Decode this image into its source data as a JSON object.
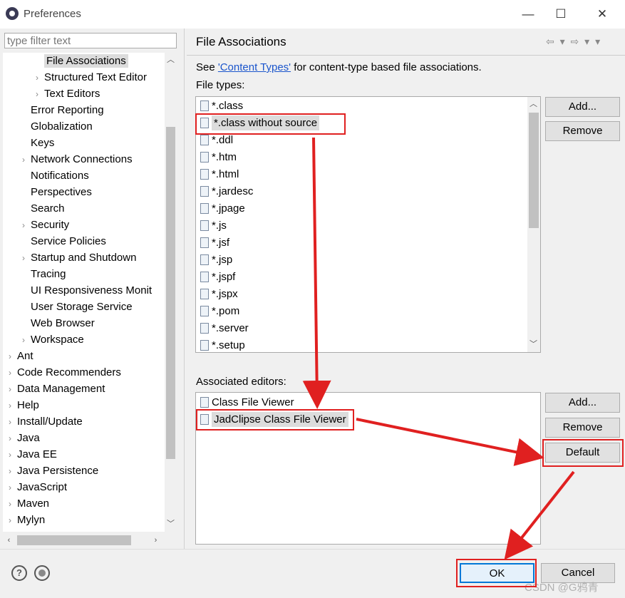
{
  "window": {
    "title": "Preferences",
    "controls": [
      "minimize-icon",
      "maximize-icon",
      "close-icon"
    ],
    "minimize": "—",
    "maximize": "☐",
    "close": "✕"
  },
  "filter": {
    "placeholder": "type filter text",
    "value": ""
  },
  "tree": {
    "items": [
      {
        "label": "File Associations",
        "indent": 2,
        "chevron": false,
        "selected": true
      },
      {
        "label": "Structured Text Editor",
        "indent": 2,
        "chevron": true
      },
      {
        "label": "Text Editors",
        "indent": 2,
        "chevron": true
      },
      {
        "label": "Error Reporting",
        "indent": 1,
        "chevron": false
      },
      {
        "label": "Globalization",
        "indent": 1,
        "chevron": false
      },
      {
        "label": "Keys",
        "indent": 1,
        "chevron": false
      },
      {
        "label": "Network Connections",
        "indent": 1,
        "chevron": true
      },
      {
        "label": "Notifications",
        "indent": 1,
        "chevron": false
      },
      {
        "label": "Perspectives",
        "indent": 1,
        "chevron": false
      },
      {
        "label": "Search",
        "indent": 1,
        "chevron": false
      },
      {
        "label": "Security",
        "indent": 1,
        "chevron": true
      },
      {
        "label": "Service Policies",
        "indent": 1,
        "chevron": false
      },
      {
        "label": "Startup and Shutdown",
        "indent": 1,
        "chevron": true
      },
      {
        "label": "Tracing",
        "indent": 1,
        "chevron": false
      },
      {
        "label": "UI Responsiveness Monit",
        "indent": 1,
        "chevron": false
      },
      {
        "label": "User Storage Service",
        "indent": 1,
        "chevron": false
      },
      {
        "label": "Web Browser",
        "indent": 1,
        "chevron": false
      },
      {
        "label": "Workspace",
        "indent": 1,
        "chevron": true
      },
      {
        "label": "Ant",
        "indent": 0,
        "chevron": true
      },
      {
        "label": "Code Recommenders",
        "indent": 0,
        "chevron": true
      },
      {
        "label": "Data Management",
        "indent": 0,
        "chevron": true
      },
      {
        "label": "Help",
        "indent": 0,
        "chevron": true
      },
      {
        "label": "Install/Update",
        "indent": 0,
        "chevron": true
      },
      {
        "label": "Java",
        "indent": 0,
        "chevron": true
      },
      {
        "label": "Java EE",
        "indent": 0,
        "chevron": true
      },
      {
        "label": "Java Persistence",
        "indent": 0,
        "chevron": true
      },
      {
        "label": "JavaScript",
        "indent": 0,
        "chevron": true
      },
      {
        "label": "Maven",
        "indent": 0,
        "chevron": true
      },
      {
        "label": "Mylyn",
        "indent": 0,
        "chevron": true
      }
    ]
  },
  "page": {
    "title": "File Associations",
    "nav": "⇦ ▾ ⇨ ▾ ▾",
    "desc_prefix": "See ",
    "desc_link": "'Content Types'",
    "desc_suffix": " for content-type based file associations.",
    "file_types_label": "File types:",
    "associated_editors_label": "Associated editors:"
  },
  "file_types": [
    {
      "name": "*.class",
      "icon": "class-file-icon"
    },
    {
      "name": "*.class without source",
      "icon": "class-file-icon",
      "selected": true
    },
    {
      "name": "*.ddl",
      "icon": "ddl-file-icon"
    },
    {
      "name": "*.htm",
      "icon": "html-file-icon"
    },
    {
      "name": "*.html",
      "icon": "html-file-icon"
    },
    {
      "name": "*.jardesc",
      "icon": "jardesc-file-icon"
    },
    {
      "name": "*.jpage",
      "icon": "jpage-file-icon"
    },
    {
      "name": "*.js",
      "icon": "js-file-icon"
    },
    {
      "name": "*.jsf",
      "icon": "text-file-icon"
    },
    {
      "name": "*.jsp",
      "icon": "text-file-icon"
    },
    {
      "name": "*.jspf",
      "icon": "text-file-icon"
    },
    {
      "name": "*.jspx",
      "icon": "text-file-icon"
    },
    {
      "name": "*.pom",
      "icon": "maven-file-icon"
    },
    {
      "name": "*.server",
      "icon": "server-file-icon"
    },
    {
      "name": "*.setup",
      "icon": "setup-file-icon"
    }
  ],
  "associated_editors": [
    {
      "name": "Class File Viewer",
      "icon": "class-file-icon"
    },
    {
      "name": "JadClipse Class File Viewer",
      "icon": "class-file-icon",
      "selected": true
    }
  ],
  "buttons": {
    "ft_add": "Add...",
    "ft_remove": "Remove",
    "ed_add": "Add...",
    "ed_remove": "Remove",
    "ed_default": "Default",
    "ok": "OK",
    "cancel": "Cancel"
  },
  "footer": {
    "help": "?",
    "watermark": "CSDN @G鸦青"
  },
  "colors": {
    "annotation": "#e02020",
    "link": "#1a55cc",
    "selection": "#dcdcdc"
  }
}
